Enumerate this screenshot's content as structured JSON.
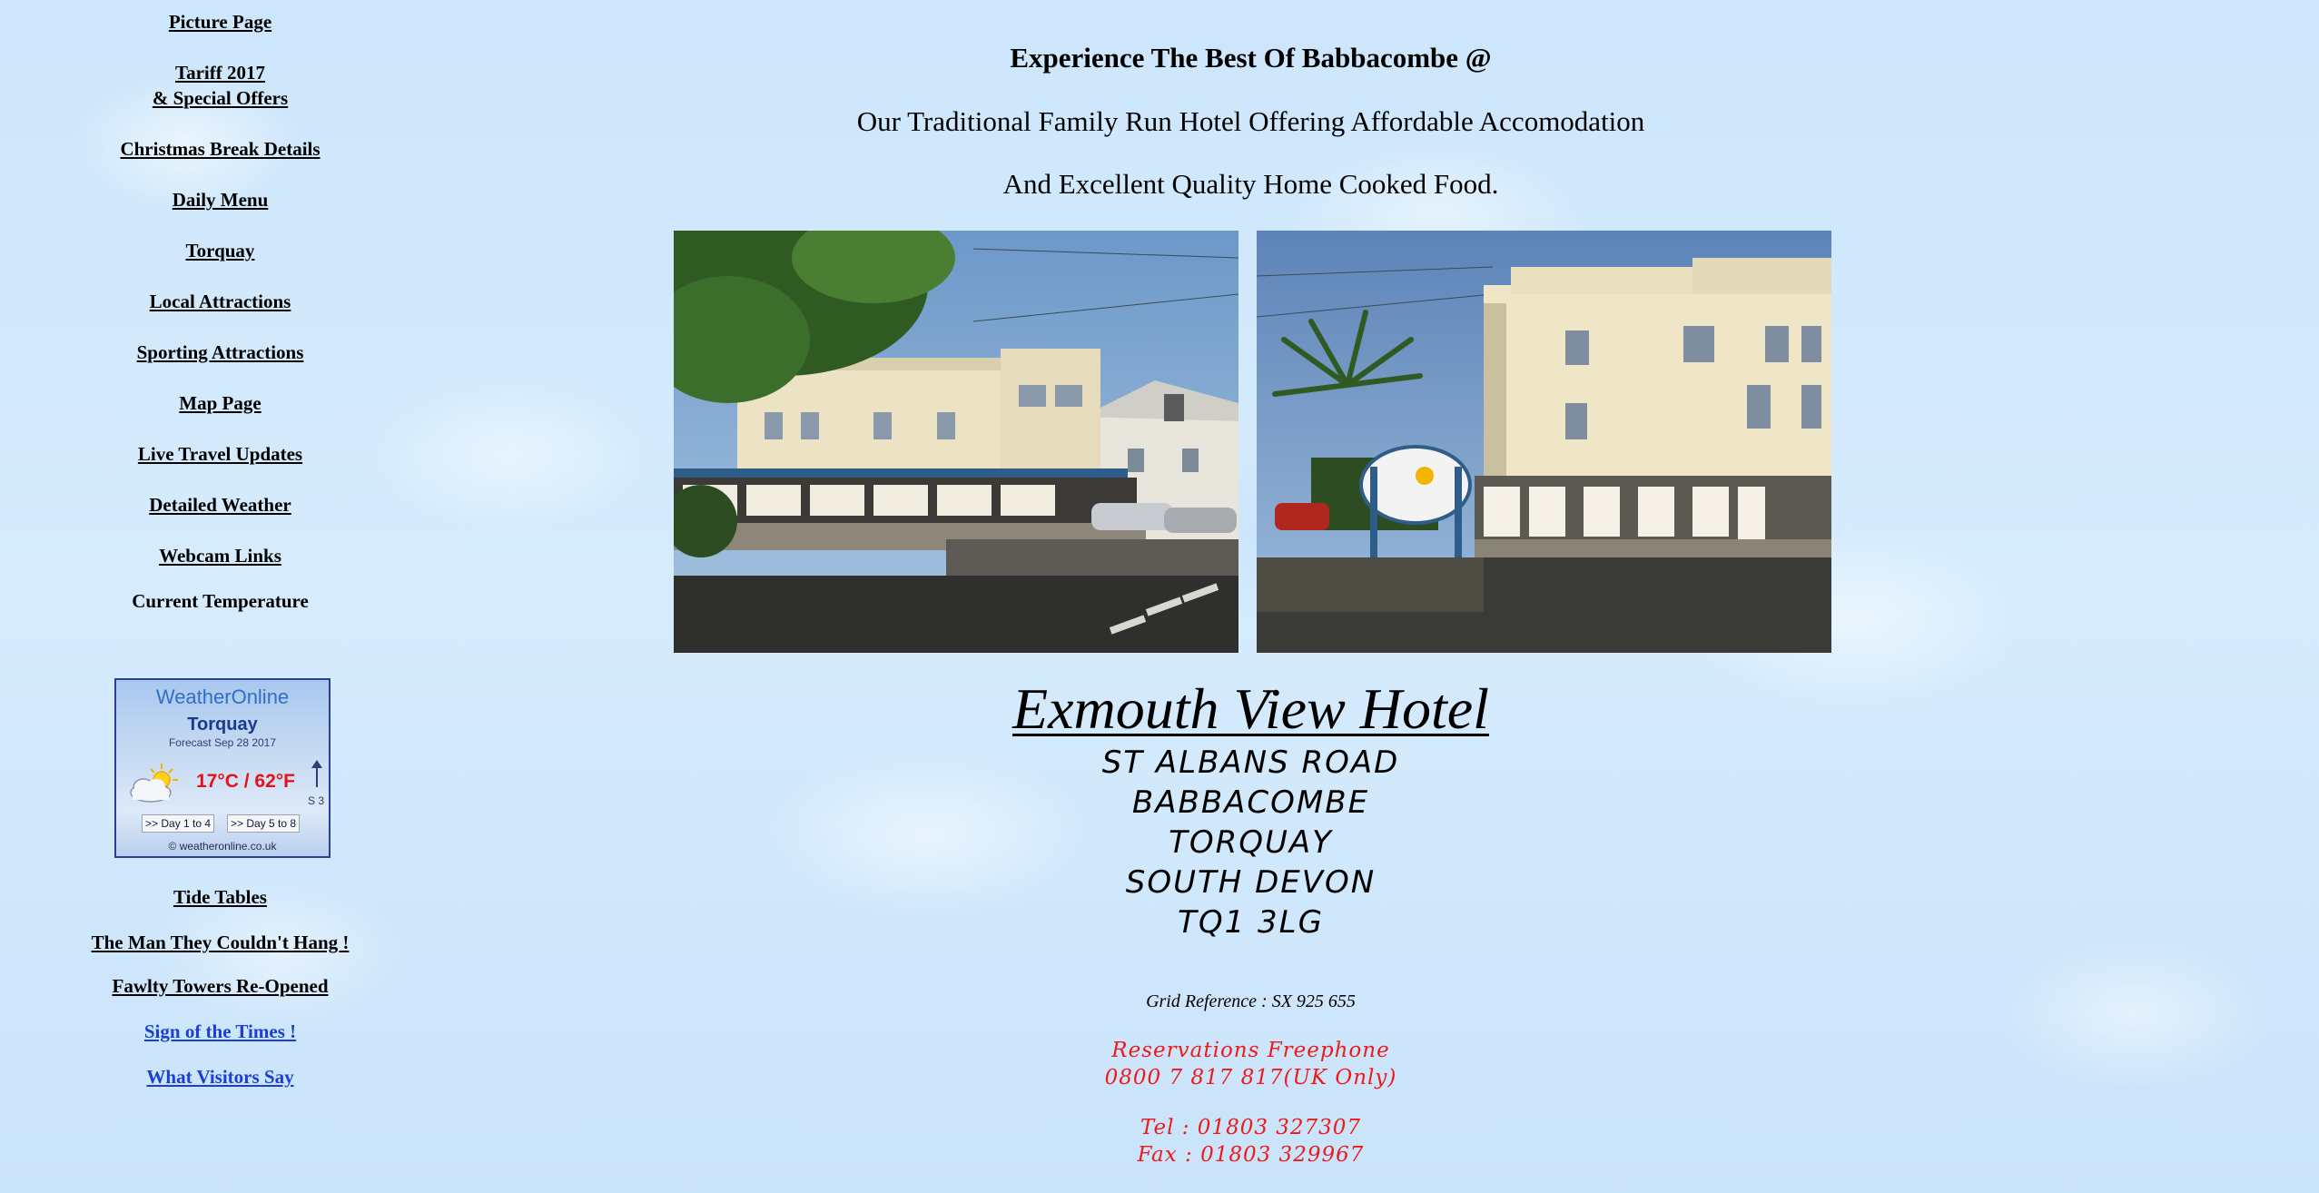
{
  "sidebar": {
    "links": [
      {
        "label": "Picture Page"
      },
      {
        "label_line1": "Tariff 2017 ",
        "label_line2": "& Special Offers"
      },
      {
        "label": "Christmas Break Details"
      },
      {
        "label": "Daily Menu"
      },
      {
        "label": "Torquay"
      },
      {
        "label": "Local Attractions"
      },
      {
        "label": "Sporting Attractions"
      },
      {
        "label": "Map Page"
      },
      {
        "label": "Live Travel Updates"
      },
      {
        "label": "Detailed Weather"
      },
      {
        "label": "Webcam Links"
      }
    ],
    "current_temperature": "Current Temperature",
    "lower_links": [
      {
        "label": "Tide Tables"
      },
      {
        "label": "The Man They Couldn't Hang !"
      },
      {
        "label": "Fawlty Towers Re-Opened"
      },
      {
        "label": "Sign of the Times !"
      },
      {
        "label": "What Visitors Say"
      }
    ]
  },
  "weather_widget": {
    "brand": "WeatherOnline",
    "city": "Torquay",
    "forecast_date": "Forecast Sep 28 2017",
    "temperature": "17°C / 62°F",
    "wind": "S 3",
    "button_day1": ">> Day 1 to 4",
    "button_day5": ">> Day 5 to 8",
    "copyright": "© weatheronline.co.uk",
    "icon": "partly-cloudy-icon"
  },
  "main": {
    "heading": "Experience The Best Of Babbacombe @",
    "tagline1": "Our Traditional Family Run Hotel Offering Affordable Accomodation",
    "tagline2": "And Excellent Quality Home Cooked Food.",
    "hotel_name": "Exmouth View Hotel",
    "address": [
      "ST ALBANS ROAD",
      "BABBACOMBE",
      "TORQUAY",
      "SOUTH DEVON",
      "TQ1 3LG"
    ],
    "grid_reference": "Grid Reference : SX 925 655",
    "reservations_label": "Reservations Freephone",
    "freephone": "0800 7 817 817(UK Only)",
    "tel": "Tel : 01803 327307",
    "fax": "Fax : 01803 329967"
  },
  "colors": {
    "link_blue": "#1a3fd6",
    "phone_red": "#ee1a1a",
    "weather_temp_red": "#e8101a"
  }
}
